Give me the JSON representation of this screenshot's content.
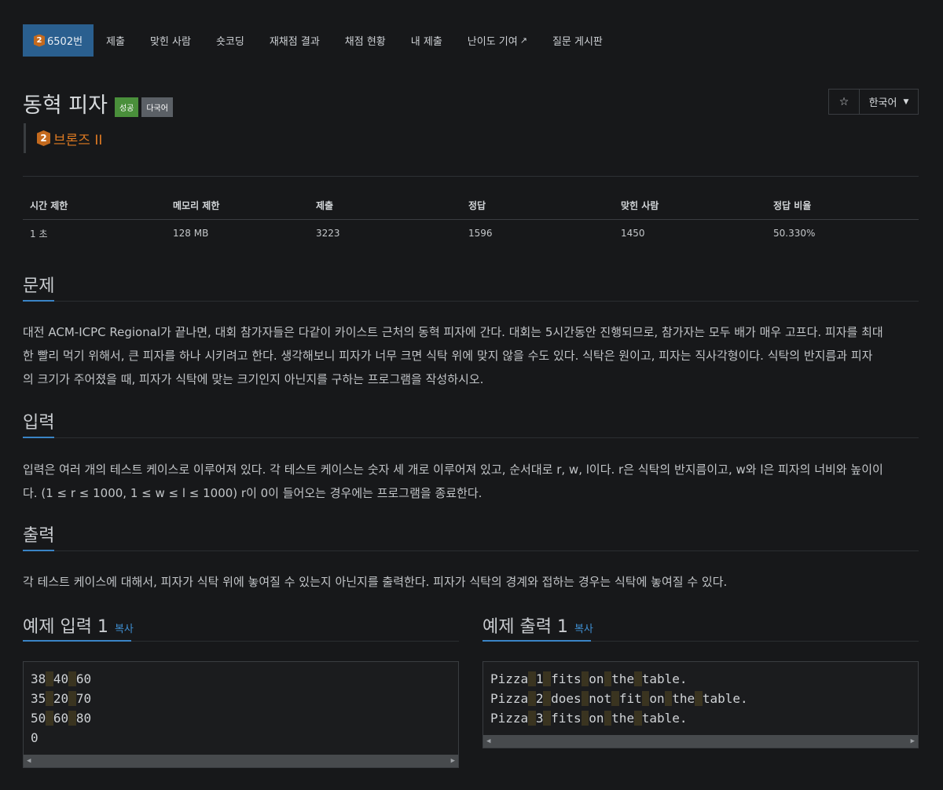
{
  "tabs": [
    {
      "label": "6502번",
      "tier": "2"
    },
    {
      "label": "제출"
    },
    {
      "label": "맞힌 사람"
    },
    {
      "label": "숏코딩"
    },
    {
      "label": "재채점 결과"
    },
    {
      "label": "채점 현황"
    },
    {
      "label": "내 제출"
    },
    {
      "label": "난이도 기여"
    },
    {
      "label": "질문 게시판"
    }
  ],
  "problem": {
    "title": "동혁 피자",
    "status_label": "성공",
    "lang_label": "다국어",
    "tier_number": "2",
    "tier_text": "브론즈 II"
  },
  "controls": {
    "star": "☆",
    "language": "한국어"
  },
  "colors": {
    "active_tab": "#2a5f8f",
    "tier": "#e07b22",
    "accent": "#3a84c6",
    "success": "#4a8f3b"
  },
  "info_table": {
    "headers": [
      "시간 제한",
      "메모리 제한",
      "제출",
      "정답",
      "맞힌 사람",
      "정답 비율"
    ],
    "values": [
      "1 초",
      "128 MB",
      "3223",
      "1596",
      "1450",
      "50.330%"
    ]
  },
  "sections": {
    "problem_title": "문제",
    "problem_text_1": "대전 ACM-ICPC Regional가 끝나면, 대회 참가자들은 다같이 카이스트 근처의 동혁 피자에 간다. 대회는 5시간동안 진행되므로, 참가자는 모두 배가 매우 고프다. 피자를 최대",
    "problem_text_2": "한 빨리 먹기 위해서, 큰 피자를 하나 시키려고 한다. 생각해보니 피자가 너무 크면 식탁 위에 맞지 않을 수도 있다. 식탁은 원이고, 피자는 직사각형이다. 식탁의 반지름과 피자",
    "problem_text_3": "의 크기가 주어졌을 때, 피자가 식탁에 맞는 크기인지 아닌지를 구하는 프로그램을 작성하시오.",
    "input_title": "입력",
    "input_text_1": "입력은 여러 개의 테스트 케이스로 이루어져 있다. 각 테스트 케이스는 숫자 세 개로 이루어져 있고, 순서대로 r, w, l이다. r은 식탁의 반지름이고, w와 l은 피자의 너비와 높이이",
    "input_text_2": "다. (1 ≤ r ≤ 1000, 1 ≤ w ≤ l ≤ 1000) r이 0이 들어오는 경우에는 프로그램을 종료한다.",
    "output_title": "출력",
    "output_text": "각 테스트 케이스에 대해서, 피자가 식탁 위에 놓여질 수 있는지 아닌지를 출력한다. 피자가 식탁의 경계와 접하는 경우는 식탁에 놓여질 수 있다."
  },
  "samples": {
    "input_title": "예제 입력 1",
    "output_title": "예제 출력 1",
    "copy_label": "복사",
    "input_lines": [
      [
        "38",
        "40",
        "60"
      ],
      [
        "35",
        "20",
        "70"
      ],
      [
        "50",
        "60",
        "80"
      ],
      [
        "0"
      ]
    ],
    "output_lines": [
      [
        "Pizza",
        "1",
        "fits",
        "on",
        "the",
        "table."
      ],
      [
        "Pizza",
        "2",
        "does",
        "not",
        "fit",
        "on",
        "the",
        "table."
      ],
      [
        "Pizza",
        "3",
        "fits",
        "on",
        "the",
        "table."
      ]
    ]
  }
}
